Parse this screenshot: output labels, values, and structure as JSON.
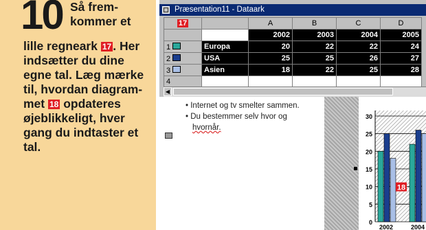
{
  "instruction": {
    "step_number": "10",
    "text_top": "Så frem-kommer et",
    "text_line": "lille regneark",
    "badge_17": "17",
    "text_after_badge": ".",
    "text_body1": "Her indsætter du dine egne tal. Læg mærke til, hvordan diagram-met",
    "badge_18": "18",
    "text_body2": "opdateres øjeblikkeligt, hver gang du indtaster et tal."
  },
  "window": {
    "title": "Præsentation11 - Dataark"
  },
  "datasheet": {
    "corner_badge": "17",
    "columns": [
      "A",
      "B",
      "C",
      "D"
    ],
    "header_row": [
      "2002",
      "2003",
      "2004",
      "2005"
    ],
    "rows": [
      {
        "num": "1",
        "label": "Europa",
        "values": [
          "20",
          "22",
          "22",
          "24"
        ]
      },
      {
        "num": "2",
        "label": "USA",
        "values": [
          "25",
          "25",
          "26",
          "27"
        ]
      },
      {
        "num": "3",
        "label": "Asien",
        "values": [
          "18",
          "22",
          "25",
          "28"
        ]
      },
      {
        "num": "4",
        "label": "",
        "values": [
          "",
          "",
          "",
          ""
        ]
      }
    ]
  },
  "slide": {
    "bullets": [
      "Internet og tv smelter sammen.",
      "Du bestemmer selv hvor og",
      "hvornår."
    ]
  },
  "chart_data": {
    "type": "bar",
    "categories": [
      "2002",
      "2004"
    ],
    "ylim": [
      0,
      30
    ],
    "yticks": [
      "0",
      "5",
      "10",
      "15",
      "20",
      "25",
      "30"
    ],
    "badge": "18",
    "series": [
      {
        "name": "Europa",
        "values": [
          20,
          22
        ],
        "color": "#2aa79a"
      },
      {
        "name": "USA",
        "values": [
          25,
          26
        ],
        "color": "#1a3e8e"
      },
      {
        "name": "Asien",
        "values": [
          18,
          25
        ],
        "color": "#a9bfe6"
      }
    ],
    "grid": true
  },
  "colors": {
    "panel": "#f8d79a",
    "badge": "#e01e24",
    "titlebar": "#0a2a73"
  }
}
